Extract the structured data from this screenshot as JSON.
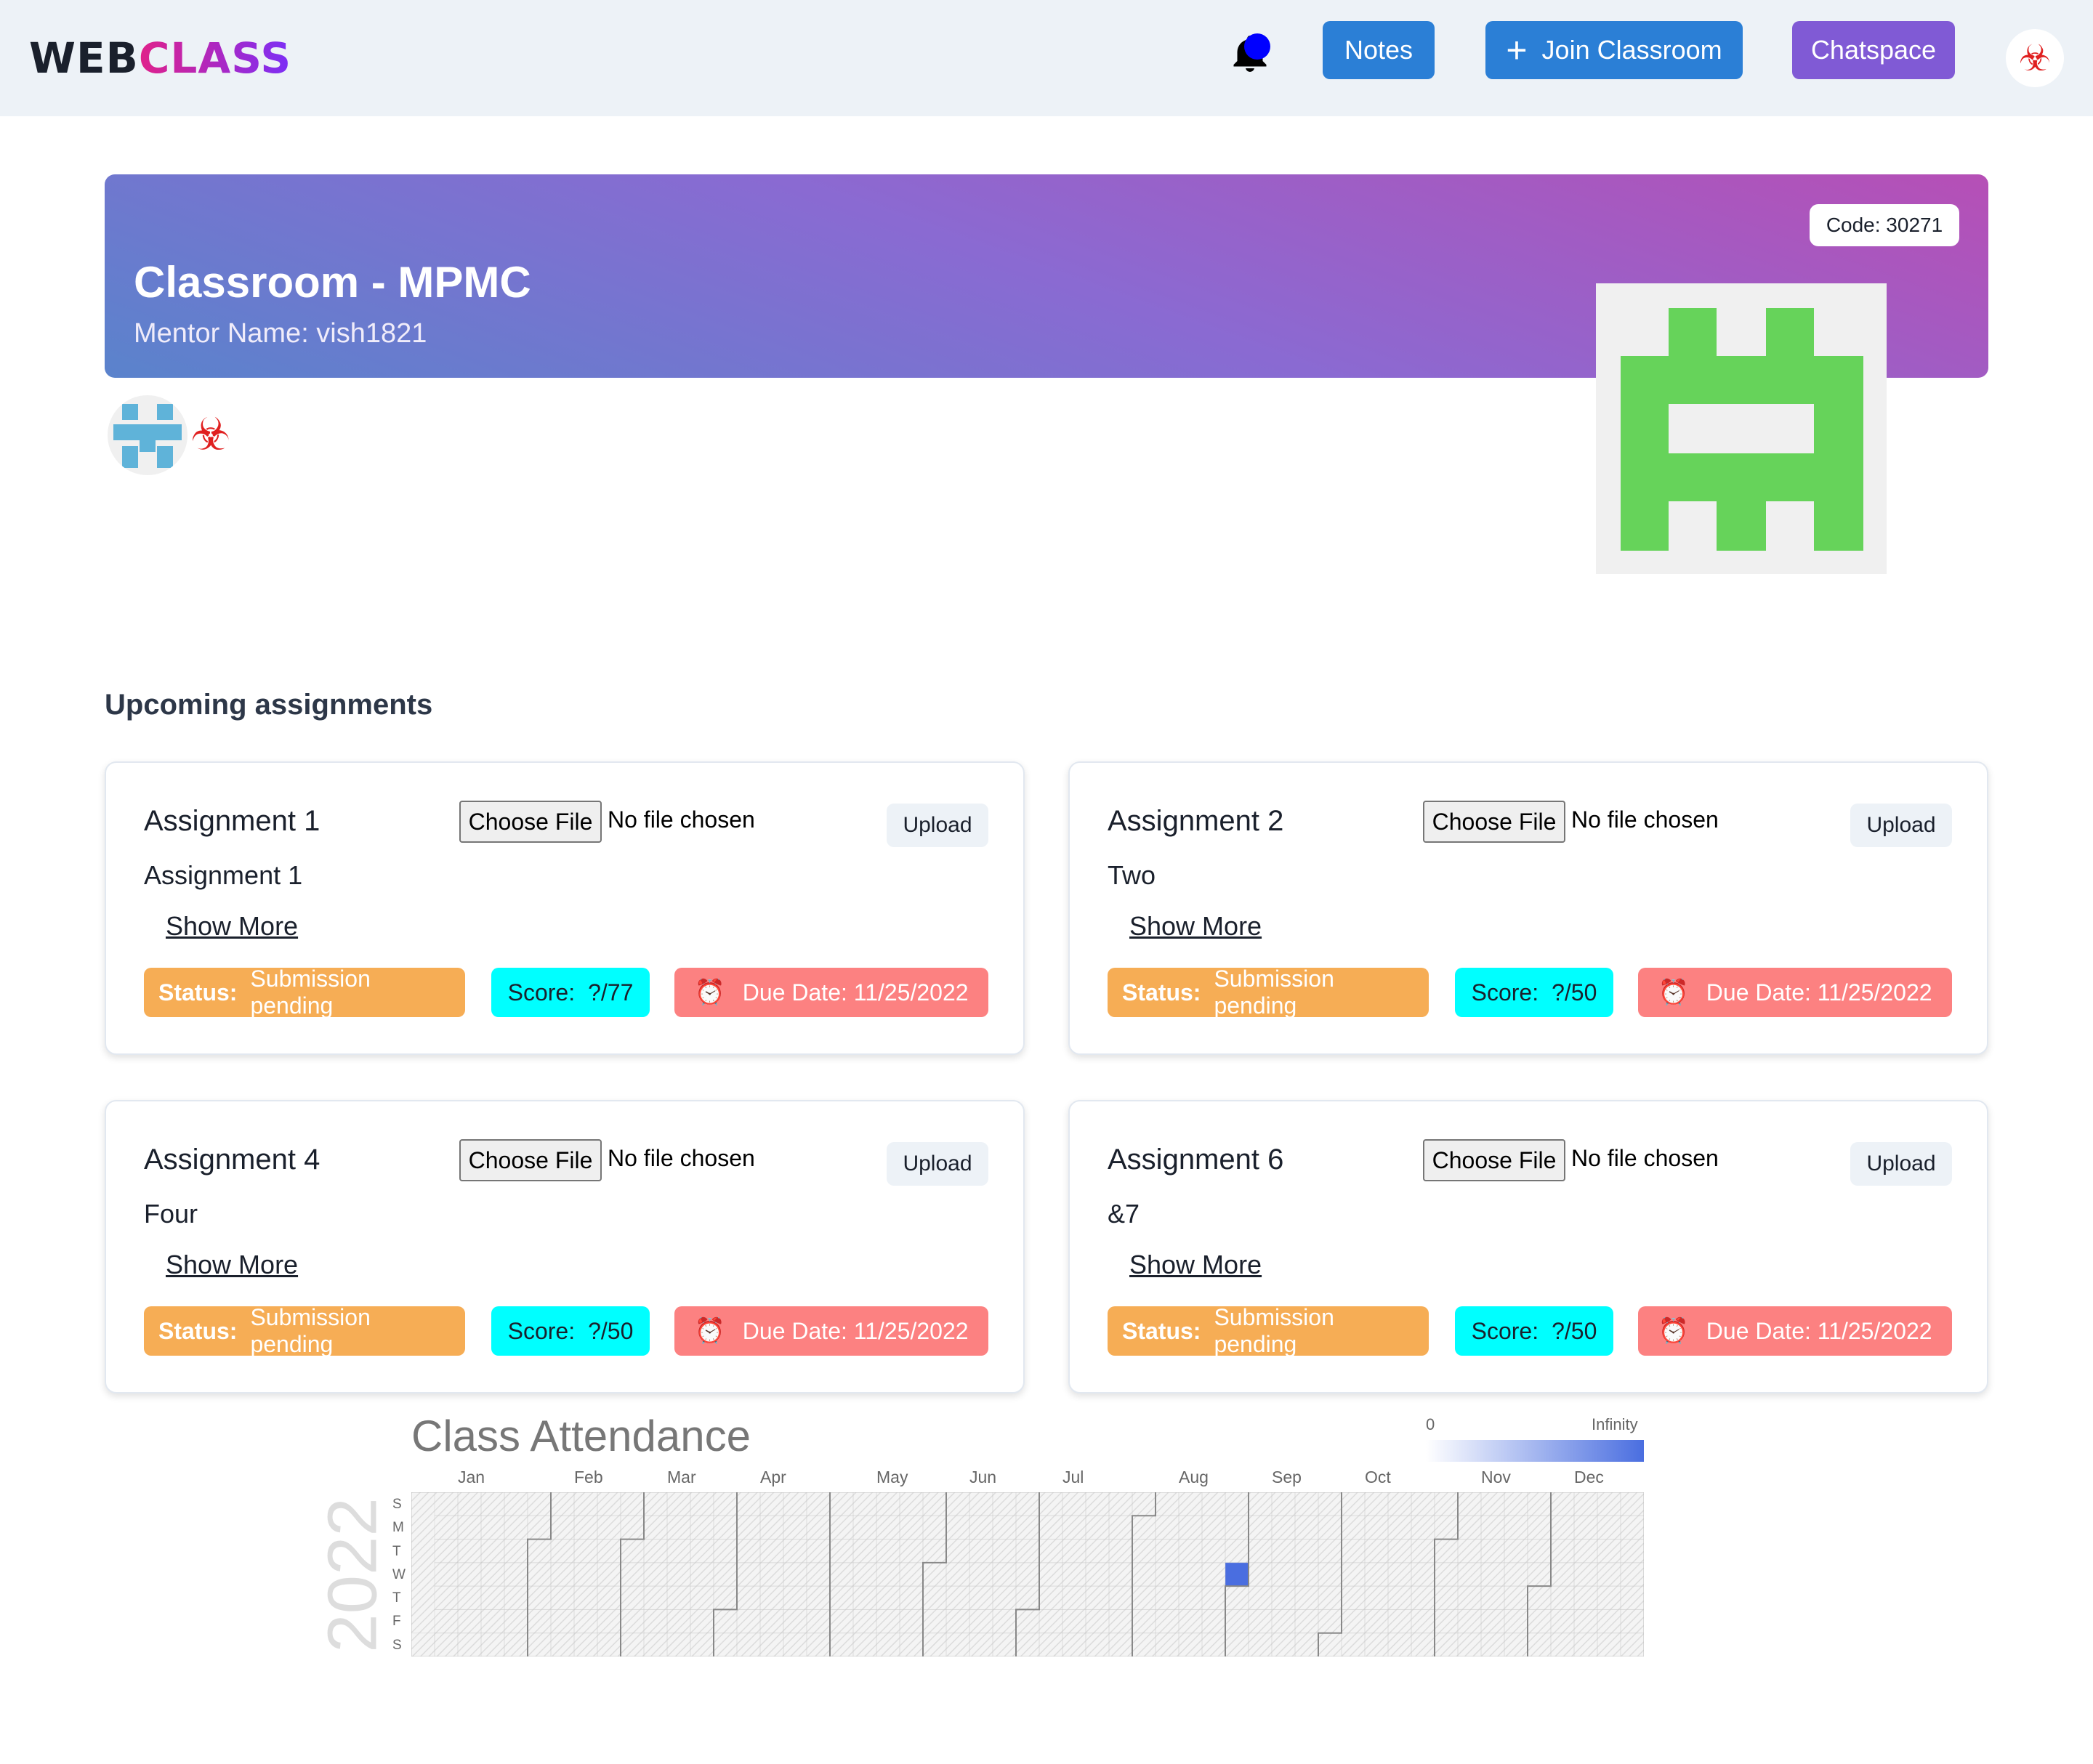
{
  "header": {
    "logo_web": "WEB",
    "logo_class": "CLASS",
    "notes_label": "Notes",
    "join_label": "Join Classroom",
    "chat_label": "Chatspace",
    "profile_icon": "biohazard-icon"
  },
  "classroom": {
    "title": "Classroom - MPMC",
    "mentor": "Mentor Name: vish1821",
    "code": "Code: 30271",
    "identicon_color": "#66d35a"
  },
  "assignments_title": "Upcoming assignments",
  "assignments": [
    {
      "title": "Assignment 1",
      "choose_file": "Choose File",
      "file_status": "No file chosen",
      "upload": "Upload",
      "desc": "Assignment 1",
      "show_more": "Show More",
      "status_label": "Status:",
      "status": "Submission pending",
      "score_label": "Score:",
      "score": "?/77",
      "due": "Due Date: 11/25/2022"
    },
    {
      "title": "Assignment 2",
      "choose_file": "Choose File",
      "file_status": "No file chosen",
      "upload": "Upload",
      "desc": "Two",
      "show_more": "Show More",
      "status_label": "Status:",
      "status": "Submission pending",
      "score_label": "Score:",
      "score": "?/50",
      "due": "Due Date: 11/25/2022"
    },
    {
      "title": "Assignment 4",
      "choose_file": "Choose File",
      "file_status": "No file chosen",
      "upload": "Upload",
      "desc": "Four",
      "show_more": "Show More",
      "status_label": "Status:",
      "status": "Submission pending",
      "score_label": "Score:",
      "score": "?/50",
      "due": "Due Date: 11/25/2022"
    },
    {
      "title": "Assignment 6",
      "choose_file": "Choose File",
      "file_status": "No file chosen",
      "upload": "Upload",
      "desc": "&7",
      "show_more": "Show More",
      "status_label": "Status:",
      "status": "Submission pending",
      "score_label": "Score:",
      "score": "?/50",
      "due": "Due Date: 11/25/2022"
    }
  ],
  "colors": {
    "status": "#f6ad55",
    "score": "#00ffff",
    "due": "#fc8181",
    "primary": "#2b7fd6",
    "purple": "#805ad5"
  },
  "attendance": {
    "title": "Class Attendance",
    "year": "2022",
    "legend_min": "0",
    "legend_max": "Infinity",
    "months": [
      "Jan",
      "Feb",
      "Mar",
      "Apr",
      "May",
      "Jun",
      "Jul",
      "Aug",
      "Sep",
      "Oct",
      "Nov",
      "Dec"
    ],
    "days": [
      "S",
      "M",
      "T",
      "W",
      "T",
      "F",
      "S"
    ]
  },
  "chart_data": {
    "type": "heatmap",
    "title": "Class Attendance",
    "year": 2022,
    "scale_min": "0",
    "scale_max": "Infinity",
    "x_labels": [
      "Jan",
      "Feb",
      "Mar",
      "Apr",
      "May",
      "Jun",
      "Jul",
      "Aug",
      "Sep",
      "Oct",
      "Nov",
      "Dec"
    ],
    "y_labels": [
      "S",
      "M",
      "T",
      "W",
      "T",
      "F",
      "S"
    ],
    "highlighted_days": [
      "2022-08-31"
    ]
  }
}
